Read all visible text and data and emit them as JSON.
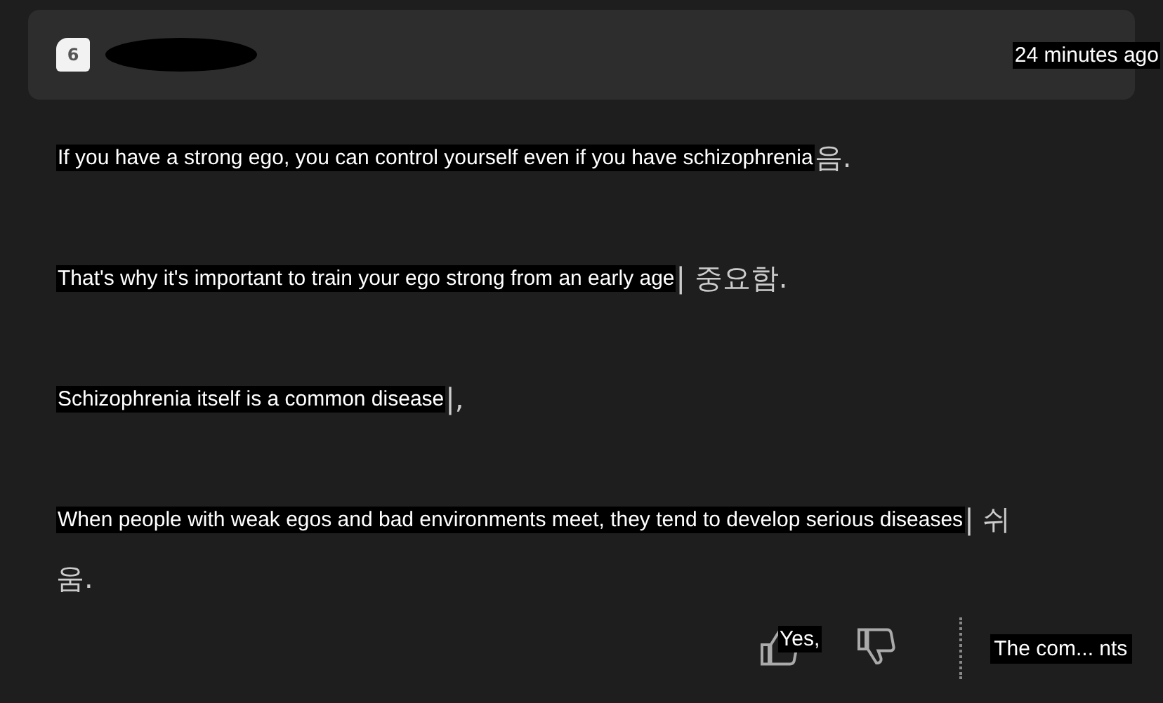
{
  "header": {
    "level_badge": "6",
    "time": "24 minutes ago"
  },
  "paragraphs": [
    {
      "translation": "If you have a strong ego, you can control yourself even if you have schizophrenia",
      "tail": "음."
    },
    {
      "translation": "That's why it's important to train your ego strong from an early age",
      "tail": "| 중요함."
    },
    {
      "translation": "Schizophrenia itself is a common disease",
      "tail": "|,"
    },
    {
      "translation": "When people with weak egos and bad environments meet, they tend to develop serious diseases",
      "tail": "| 쉬",
      "continuation": "움."
    }
  ],
  "footer": {
    "like_label": "Yes,",
    "comments_label": "The com... nts"
  }
}
